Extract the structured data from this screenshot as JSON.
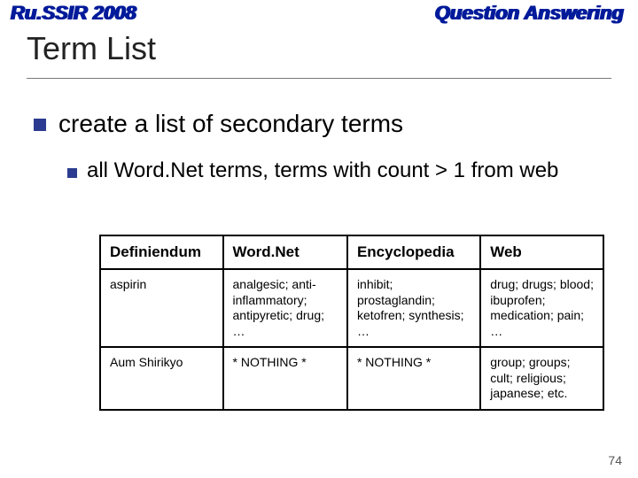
{
  "header": {
    "left": "Ru.SSIR 2008",
    "right": "Question Answering"
  },
  "title": "Term List",
  "bullets": {
    "level1": "create a list of secondary terms",
    "level2": "all Word.Net terms, terms with count > 1 from web"
  },
  "table": {
    "headers": [
      "Definiendum",
      "Word.Net",
      "Encyclopedia",
      "Web"
    ],
    "rows": [
      {
        "c0": "aspirin",
        "c1": "analgesic; anti-inflammatory; antipyretic; drug; …",
        "c2": "inhibit; prostaglandin; ketofren; synthesis; …",
        "c3": "drug; drugs; blood; ibuprofen; medication; pain; …"
      },
      {
        "c0": "Aum Shirikyo",
        "c1": "* NOTHING *",
        "c2": "* NOTHING *",
        "c3": "group; groups; cult; religious; japanese; etc."
      }
    ]
  },
  "page_number": "74"
}
